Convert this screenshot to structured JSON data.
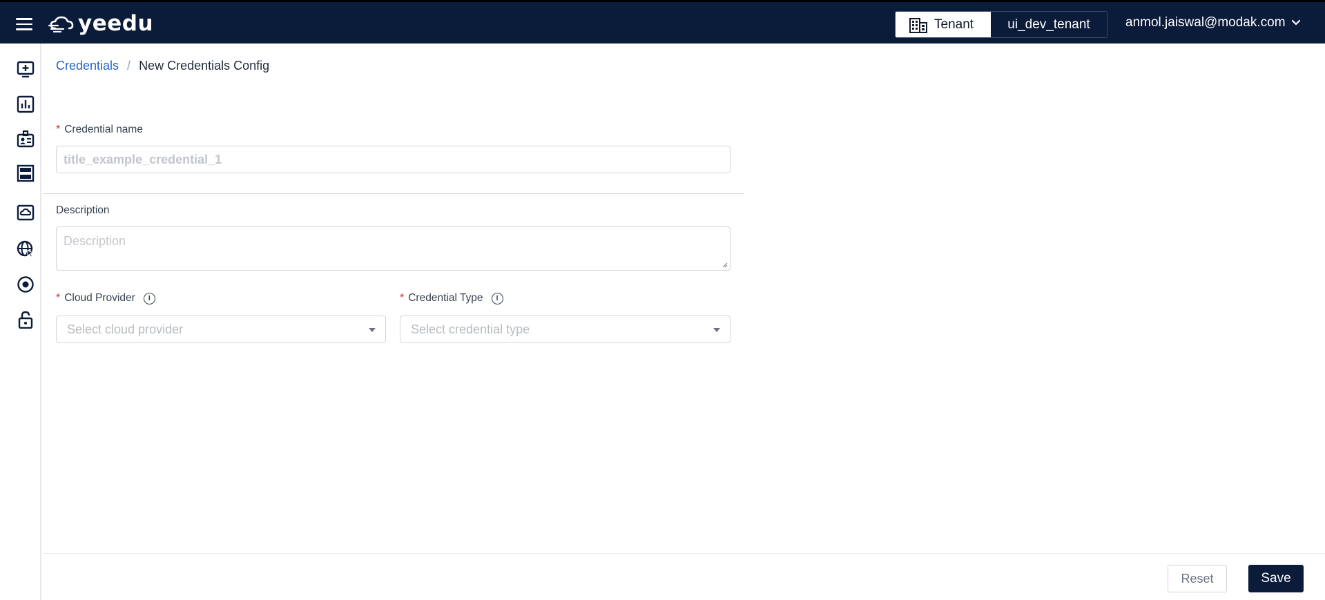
{
  "header": {
    "logo_text": "yeedu",
    "tenant_label": "Tenant",
    "tenant_value": "ui_dev_tenant",
    "user_email": "anmol.jaiswal@modak.com"
  },
  "sidebar": {
    "items": [
      {
        "icon": "add-screen-icon"
      },
      {
        "icon": "bar-chart-icon"
      },
      {
        "icon": "id-badge-icon"
      },
      {
        "icon": "server-rack-icon"
      },
      {
        "icon": "cloud-drive-icon"
      },
      {
        "icon": "globe-cursor-icon"
      },
      {
        "icon": "target-circle-icon"
      },
      {
        "icon": "lock-icon"
      }
    ]
  },
  "breadcrumb": {
    "parent": "Credentials",
    "separator": "/",
    "current": "New Credentials Config"
  },
  "form": {
    "credential_name": {
      "label": "Credential name",
      "required_mark": "*",
      "placeholder": "title_example_credential_1"
    },
    "description": {
      "label": "Description",
      "placeholder": "Description"
    },
    "cloud_provider": {
      "label": "Cloud Provider",
      "required_mark": "*",
      "placeholder": "Select cloud provider"
    },
    "credential_type": {
      "label": "Credential Type",
      "required_mark": "*",
      "placeholder": "Select credential type"
    }
  },
  "footer": {
    "reset_label": "Reset",
    "save_label": "Save"
  },
  "colors": {
    "header_bg": "#0b1b3a",
    "link": "#2563c9",
    "required": "#dc2626"
  }
}
